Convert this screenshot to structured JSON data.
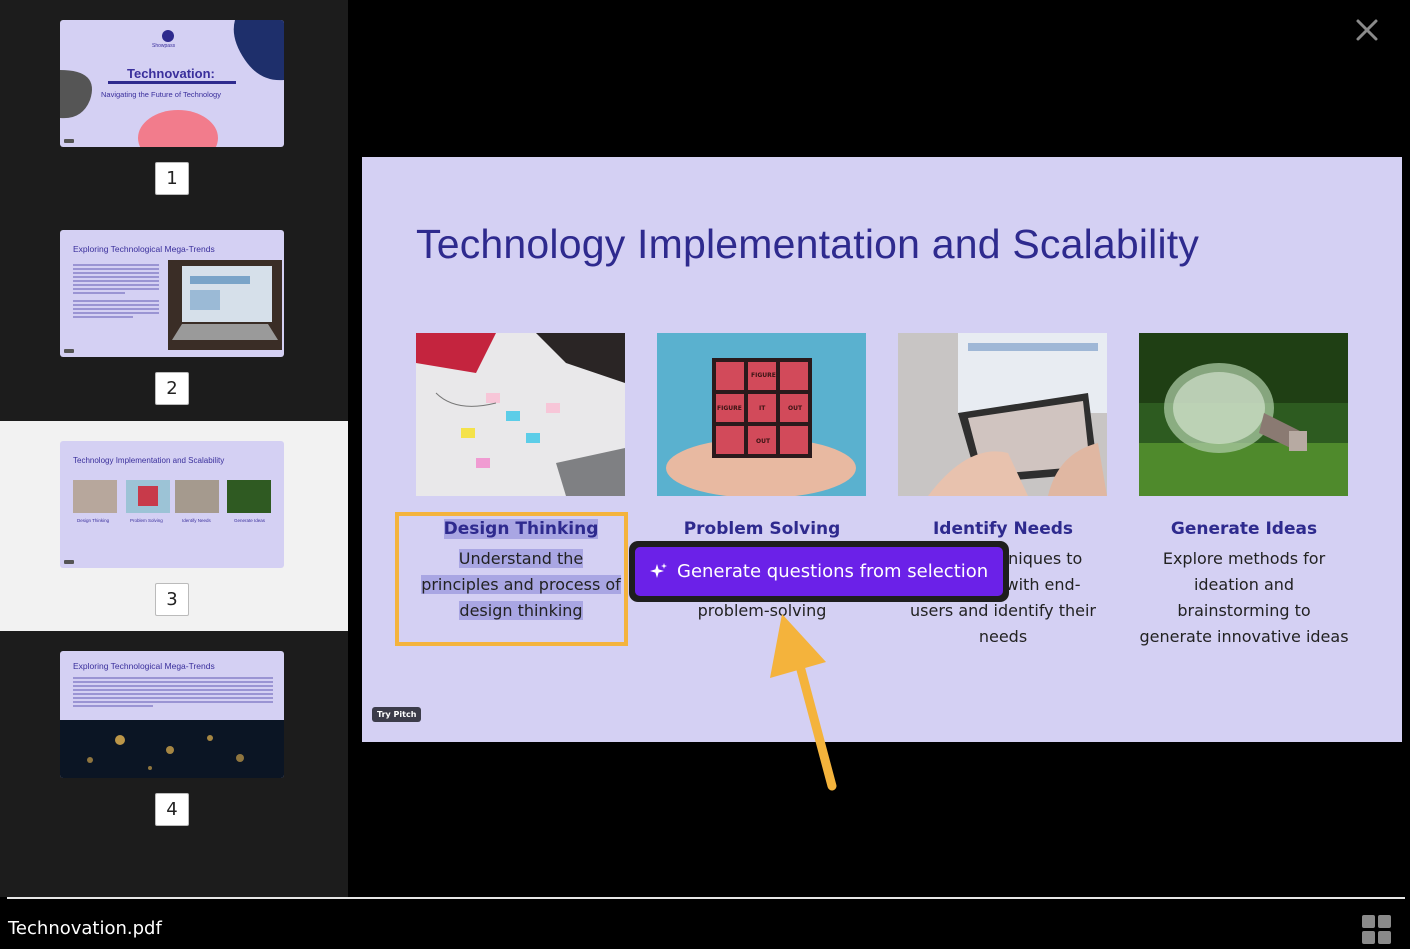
{
  "sidebar": {
    "thumbnails": [
      {
        "number": "1",
        "title": "Technovation:",
        "subtitle": "Navigating the Future of Technology",
        "brand": "Showpass"
      },
      {
        "number": "2",
        "title": "Exploring Technological Mega-Trends"
      },
      {
        "number": "3",
        "title": "Technology Implementation and Scalability",
        "cards": [
          "Design Thinking",
          "Problem Solving",
          "Identify Needs",
          "Generate Ideas"
        ]
      },
      {
        "number": "4",
        "title": "Exploring Technological Mega-Trends"
      }
    ],
    "active_index": 3
  },
  "slide": {
    "title": "Technology Implementation and Scalability",
    "cards": [
      {
        "heading": "Design Thinking",
        "desc_lines": [
          "Understand the",
          "principles and process of",
          "design thinking"
        ]
      },
      {
        "heading": "Problem Solving",
        "desc_lines": [
          "problem-solving"
        ]
      },
      {
        "heading": "Identify Needs",
        "desc_lines": [
          "iniques to",
          "with end-",
          "users and identify their",
          "needs"
        ]
      },
      {
        "heading": "Generate Ideas",
        "desc_lines": [
          "Explore methods for",
          "ideation and",
          "brainstorming to",
          "generate innovative ideas"
        ]
      }
    ],
    "badge": "Try Pitch"
  },
  "popup": {
    "label": "Generate questions from selection",
    "icon": "sparkle-icon"
  },
  "footer": {
    "filename": "Technovation.pdf"
  },
  "colors": {
    "accent_purple": "#6b21e8",
    "highlight": "#f4b33c",
    "slide_bg": "#d4d0f3",
    "title": "#2e2a8e"
  }
}
